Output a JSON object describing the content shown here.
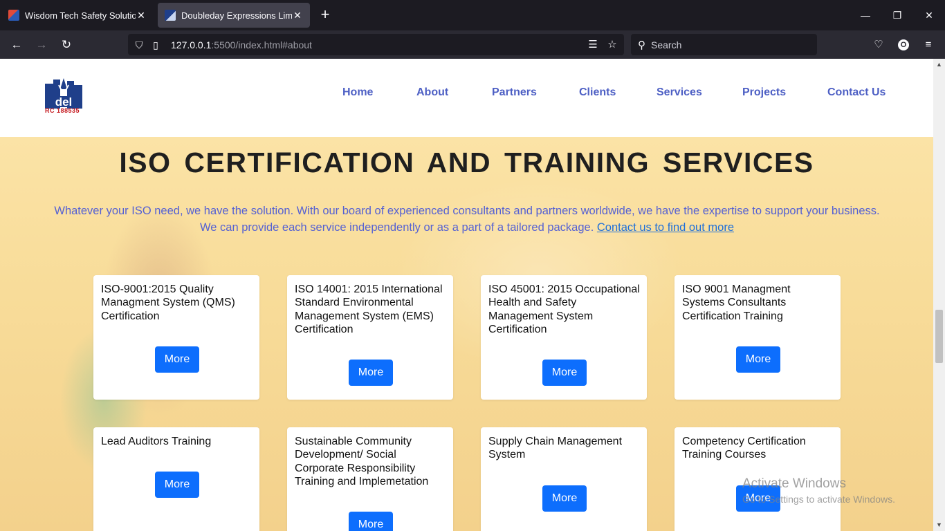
{
  "browser": {
    "tabs": [
      {
        "title": "Wisdom Tech Safety Solution",
        "active": false
      },
      {
        "title": "Doubleday Expressions Limited",
        "active": true
      }
    ],
    "url_host": "127.0.0.1",
    "url_rest": ":5500/index.html#about",
    "search_placeholder": "Search",
    "profile_initial": "O"
  },
  "site": {
    "logo_text": "del",
    "logo_rc": "RC 188535",
    "nav": [
      "Home",
      "About",
      "Partners",
      "Clients",
      "Services",
      "Projects",
      "Contact Us"
    ]
  },
  "hero": {
    "title": "ISO CERTIFICATION AND TRAINING SERVICES",
    "intro_line1": "Whatever your ISO need, we have the solution. With our board of experienced consultants and partners worldwide, we have the expertise to support your business.",
    "intro_line2": "We can provide each service independently or as a part of a tailored package.",
    "intro_link": "Contact us to find out more"
  },
  "services": [
    {
      "title": "ISO-9001:2015 Quality Managment System (QMS) Certification",
      "button": "More"
    },
    {
      "title": "ISO 14001: 2015 International Standard Environmental Management System (EMS) Certification",
      "button": "More"
    },
    {
      "title": "ISO 45001: 2015 Occupational Health and Safety Management System Certification",
      "button": "More"
    },
    {
      "title": "ISO 9001 Managment Systems Consultants Certification Training",
      "button": "More"
    },
    {
      "title": "Lead Auditors Training",
      "button": "More"
    },
    {
      "title": "Sustainable Community Development/ Social Corporate Responsibility Training and Implemetation",
      "button": "More"
    },
    {
      "title": "Supply Chain Management System",
      "button": "More"
    },
    {
      "title": "Competency Certification Training Courses",
      "button": "More"
    }
  ],
  "watermark": {
    "line1": "Activate Windows",
    "line2": "Go to Settings to activate Windows."
  },
  "colors": {
    "nav_link": "#4d5fc4",
    "intro_text": "#5561d3",
    "button": "#0d6efd",
    "hero_bg": "#f8dc99"
  }
}
